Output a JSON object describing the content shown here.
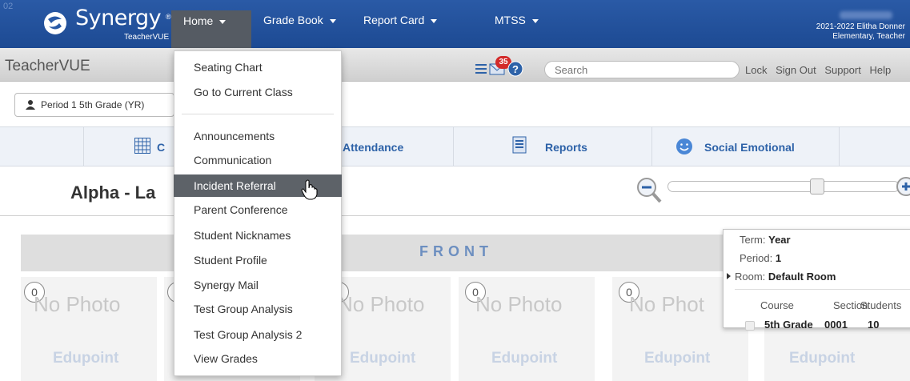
{
  "topnav": {
    "corner_num": "02",
    "brand": "Synergy",
    "brand_sub": "TeacherVUE",
    "brand_tm": "®",
    "items": [
      {
        "label": "Home"
      },
      {
        "label": "Grade Book"
      },
      {
        "label": "Report Card"
      },
      {
        "label": "MTSS"
      }
    ],
    "user_line1": "2021-2022 Elitha Donner",
    "user_line2": "Elementary, Teacher"
  },
  "subbar": {
    "title": "TeacherVUE",
    "badge": "35",
    "search_placeholder": "Search",
    "links": [
      "Lock",
      "Sign Out",
      "Support",
      "Help"
    ]
  },
  "period": {
    "label": "Period 1 5th Grade (YR)"
  },
  "tabs": [
    {
      "label": "C"
    },
    {
      "label": "Attendance"
    },
    {
      "label": "Reports"
    },
    {
      "label": "Social Emotional"
    }
  ],
  "page_title": "Alpha - La",
  "front_label": "FRONT",
  "seats": [
    {
      "num": "0",
      "photo": "No Photo",
      "logo": "Edupoint"
    },
    {
      "num": "0",
      "photo": "No Photo",
      "logo": "Edupoint"
    },
    {
      "num": "0",
      "photo": "No Photo",
      "logo": "Edupoint"
    },
    {
      "num": "0",
      "photo": "No Photo",
      "logo": "Edupoint"
    },
    {
      "num": "0",
      "photo": "No Phot",
      "logo": "Edupoint"
    },
    {
      "num": "",
      "photo": "",
      "logo": "Edupoint"
    }
  ],
  "popup": {
    "term_label": "Term:",
    "term": "Year",
    "period_label": "Period:",
    "period": "1",
    "room_label": "Room:",
    "room": "Default Room",
    "col_course": "Course",
    "col_section": "Section",
    "col_students": "Students",
    "course": "5th Grade",
    "section": "0001",
    "students": "10"
  },
  "menu": {
    "items": [
      {
        "label": "Seating Chart"
      },
      {
        "label": "Go to Current Class"
      },
      {
        "label": "Announcements"
      },
      {
        "label": "Communication"
      },
      {
        "label": "Incident Referral"
      },
      {
        "label": "Parent Conference"
      },
      {
        "label": "Student Nicknames"
      },
      {
        "label": "Student Profile"
      },
      {
        "label": "Synergy Mail"
      },
      {
        "label": "Test Group Analysis"
      },
      {
        "label": "Test Group Analysis 2"
      },
      {
        "label": "View Grades"
      }
    ],
    "highlighted": "Incident Referral"
  },
  "colors": {
    "nav_bg": "#1d4a93",
    "active_nav": "#555b63",
    "accent": "#2d62a8",
    "menu_highlight": "#5d6268"
  }
}
